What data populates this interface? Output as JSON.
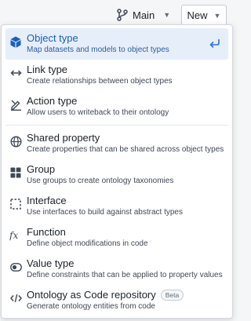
{
  "topbar": {
    "branch_label": "Main",
    "new_label": "New"
  },
  "menu": {
    "items": [
      {
        "title": "Object type",
        "desc": "Map datasets and models to object types",
        "icon": "cube-icon",
        "active": true
      },
      {
        "title": "Link type",
        "desc": "Create relationships between object types",
        "icon": "link-arrows-icon"
      },
      {
        "title": "Action type",
        "desc": "Allow users to writeback to their ontology",
        "icon": "edit-action-icon"
      },
      {
        "title": "Shared property",
        "desc": "Create properties that can be shared across object types",
        "icon": "globe-icon"
      },
      {
        "title": "Group",
        "desc": "Use groups to create ontology taxonomies",
        "icon": "grid-icon"
      },
      {
        "title": "Interface",
        "desc": "Use interfaces to build against abstract types",
        "icon": "dashed-square-icon"
      },
      {
        "title": "Function",
        "desc": "Define object modifications in code",
        "icon": "function-icon"
      },
      {
        "title": "Value type",
        "desc": "Define constraints that can be applied to property values",
        "icon": "toggle-icon"
      },
      {
        "title": "Ontology as Code repository",
        "desc": "Generate ontology entities from code",
        "icon": "code-icon",
        "badge": "Beta"
      }
    ]
  },
  "colors": {
    "accent": "#2d72d2",
    "active_bg": "#e6eefa"
  }
}
